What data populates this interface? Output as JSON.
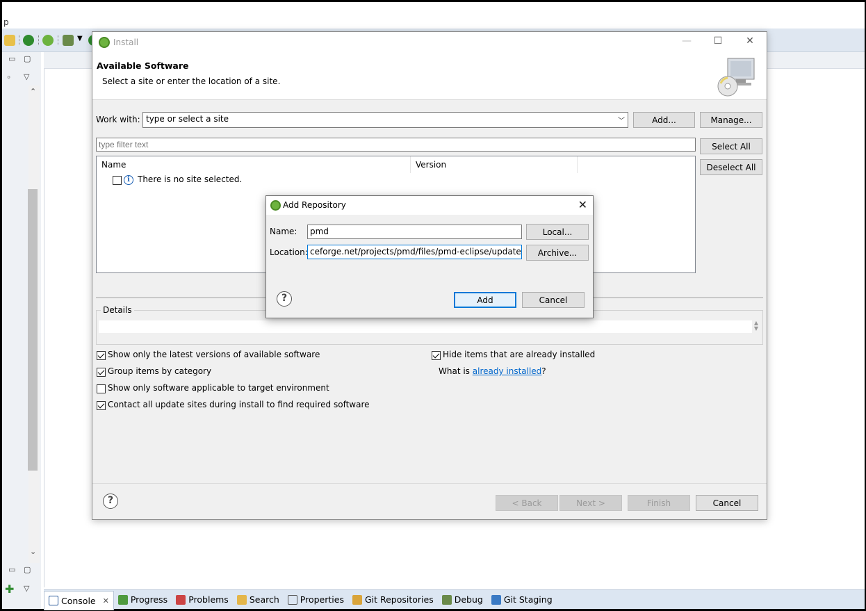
{
  "menu_fragment": "p",
  "install_dialog": {
    "title": "Install",
    "header_title": "Available Software",
    "header_subtitle": "Select a site or enter the location of a site.",
    "work_with_label": "Work with:",
    "work_with_value": "type or select a site",
    "add_button": "Add...",
    "manage_button": "Manage...",
    "filter_placeholder": "type filter text",
    "select_all_button": "Select All",
    "deselect_all_button": "Deselect All",
    "table": {
      "columns": [
        "Name",
        "Version"
      ],
      "empty_message": "There is no site selected."
    },
    "details_label": "Details",
    "options_left": [
      {
        "label": "Show only the latest versions of available software",
        "checked": true
      },
      {
        "label": "Group items by category",
        "checked": true
      },
      {
        "label": "Show only software applicable to target environment",
        "checked": false
      },
      {
        "label": "Contact all update sites during install to find required software",
        "checked": true
      }
    ],
    "hide_installed": {
      "label": "Hide items that are already installed",
      "checked": true
    },
    "what_is_prefix": "What is ",
    "what_is_link": "already installed",
    "what_is_suffix": "?",
    "buttons": {
      "back": "< Back",
      "next": "Next >",
      "finish": "Finish",
      "cancel": "Cancel"
    }
  },
  "add_repository": {
    "title": "Add Repository",
    "name_label": "Name:",
    "name_value": "pmd",
    "location_label": "Location:",
    "location_value": "ceforge.net/projects/pmd/files/pmd-eclipse/update-site",
    "local_button": "Local...",
    "archive_button": "Archive...",
    "add_button": "Add",
    "cancel_button": "Cancel"
  },
  "bottom_tabs": [
    {
      "label": "Console",
      "icon": "console-icon",
      "active": true
    },
    {
      "label": "Progress",
      "icon": "progress-icon"
    },
    {
      "label": "Problems",
      "icon": "problems-icon"
    },
    {
      "label": "Search",
      "icon": "search-icon"
    },
    {
      "label": "Properties",
      "icon": "properties-icon"
    },
    {
      "label": "Git Repositories",
      "icon": "git-repositories-icon"
    },
    {
      "label": "Debug",
      "icon": "debug-icon"
    },
    {
      "label": "Git Staging",
      "icon": "git-staging-icon"
    }
  ],
  "colors": {
    "accent": "#0078d7",
    "link": "#0066cc",
    "spring_green": "#6db33f"
  }
}
